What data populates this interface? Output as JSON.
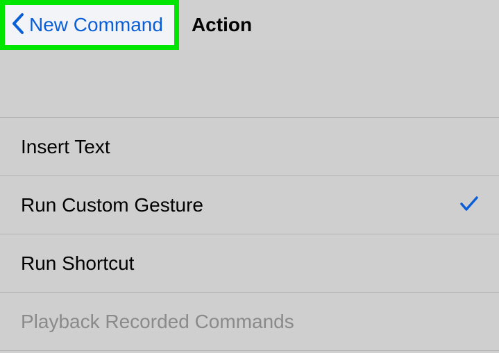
{
  "nav": {
    "back_label": "New Command",
    "title": "Action"
  },
  "options": [
    {
      "label": "Insert Text",
      "selected": false,
      "disabled": false
    },
    {
      "label": "Run Custom Gesture",
      "selected": true,
      "disabled": false
    },
    {
      "label": "Run Shortcut",
      "selected": false,
      "disabled": false
    },
    {
      "label": "Playback Recorded Commands",
      "selected": false,
      "disabled": true
    }
  ]
}
